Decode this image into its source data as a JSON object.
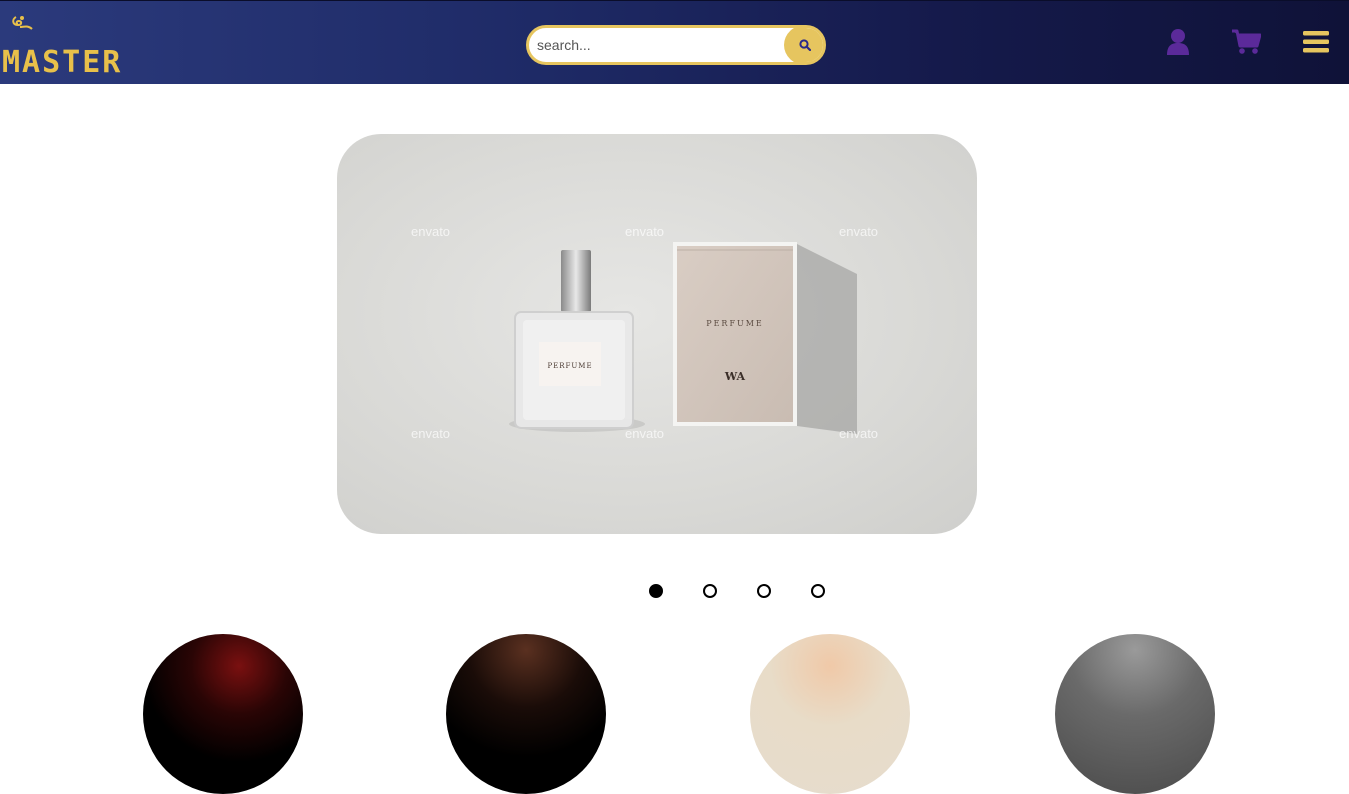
{
  "header": {
    "logo_text": "MASTER",
    "search": {
      "placeholder": "search...",
      "value": ""
    },
    "icons": {
      "search": "search-icon",
      "user": "user-icon",
      "cart": "cart-icon",
      "menu": "menu-icon"
    },
    "colors": {
      "accent": "#e6c55f",
      "icon_purple": "#5b2a9a",
      "bg_dark": "#151a4b"
    }
  },
  "carousel": {
    "slide_count": 4,
    "active_index": 0,
    "watermark_text": "envato",
    "bottle_label": "PERFUME",
    "box_label": "PERFUME",
    "box_mark": "WA"
  },
  "categories": [
    {
      "name": "category-1"
    },
    {
      "name": "category-2"
    },
    {
      "name": "category-3"
    },
    {
      "name": "category-4"
    }
  ]
}
